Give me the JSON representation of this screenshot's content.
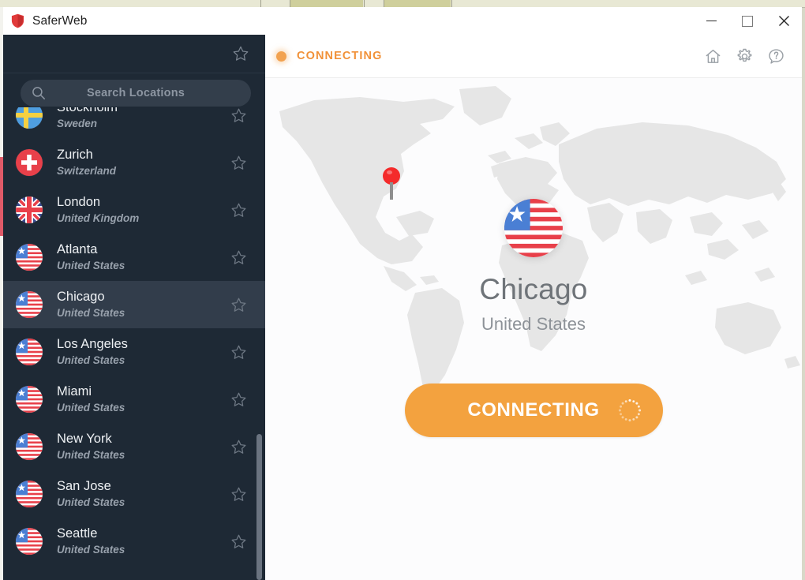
{
  "window": {
    "title": "SaferWeb",
    "app_icon": "shield-icon",
    "controls": {
      "minimize": "minimize-icon",
      "maximize": "maximize-icon",
      "close": "close-icon"
    }
  },
  "sidebar": {
    "favorites_filter_icon": "star-icon",
    "search": {
      "icon": "search-icon",
      "placeholder": "Search Locations",
      "value": ""
    },
    "locations": [
      {
        "city": "Stockholm",
        "country": "Sweden",
        "flag": "se",
        "favorite": false,
        "selected": false
      },
      {
        "city": "Zurich",
        "country": "Switzerland",
        "flag": "ch",
        "favorite": false,
        "selected": false
      },
      {
        "city": "London",
        "country": "United Kingdom",
        "flag": "gb",
        "favorite": false,
        "selected": false
      },
      {
        "city": "Atlanta",
        "country": "United States",
        "flag": "us",
        "favorite": false,
        "selected": false
      },
      {
        "city": "Chicago",
        "country": "United States",
        "flag": "us",
        "favorite": false,
        "selected": true
      },
      {
        "city": "Los Angeles",
        "country": "United States",
        "flag": "us",
        "favorite": false,
        "selected": false
      },
      {
        "city": "Miami",
        "country": "United States",
        "flag": "us",
        "favorite": false,
        "selected": false
      },
      {
        "city": "New York",
        "country": "United States",
        "flag": "us",
        "favorite": false,
        "selected": false
      },
      {
        "city": "San Jose",
        "country": "United States",
        "flag": "us",
        "favorite": false,
        "selected": false
      },
      {
        "city": "Seattle",
        "country": "United States",
        "flag": "us",
        "favorite": false,
        "selected": false
      }
    ]
  },
  "main": {
    "status": {
      "text": "CONNECTING",
      "dot_color": "#f2a250",
      "text_color": "#f19138"
    },
    "header_icons": [
      {
        "name": "home-icon",
        "glyph": "home"
      },
      {
        "name": "settings-icon",
        "glyph": "gear"
      },
      {
        "name": "help-icon",
        "glyph": "question-bubble"
      }
    ],
    "map": {
      "pin": {
        "name": "map-pin-icon",
        "color": "#f42b2b"
      },
      "land_color": "#e6e6e6",
      "ocean_color": "#fcfcfd"
    },
    "selected_location": {
      "flag": "us",
      "city": "Chicago",
      "country": "United States"
    },
    "connect_button": {
      "label": "CONNECTING",
      "color": "#f3a23f",
      "spinner": "loading-spinner-icon"
    }
  }
}
